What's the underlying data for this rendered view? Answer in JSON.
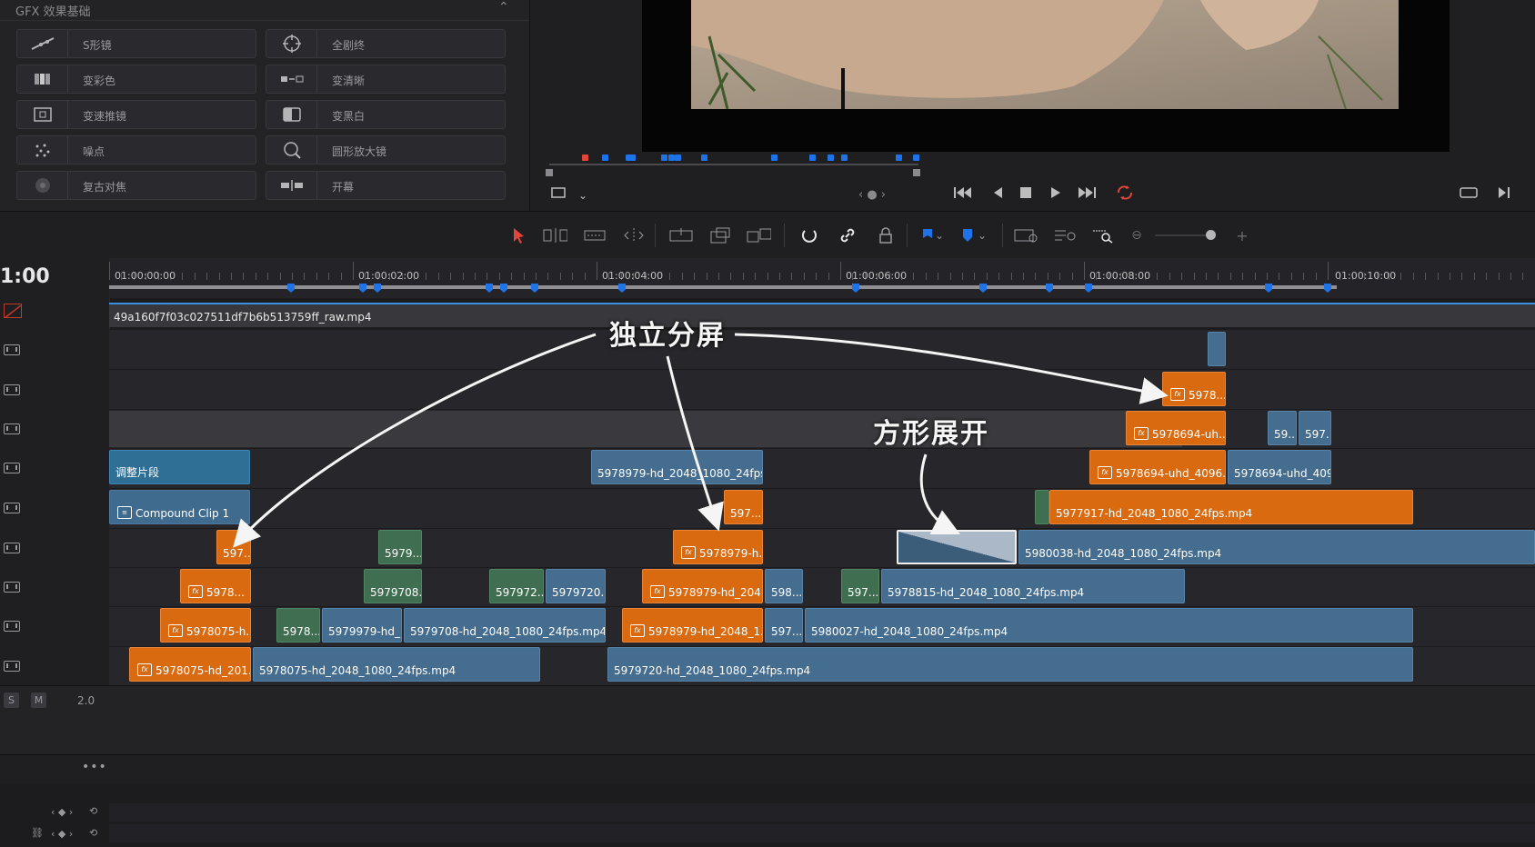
{
  "effects_panel": {
    "title": "GFX 效果基础",
    "items": [
      {
        "label": "S形镜",
        "icon": "s-curve-icon"
      },
      {
        "label": "全剧终",
        "icon": "target-icon"
      },
      {
        "label": "变彩色",
        "icon": "color-bars-icon"
      },
      {
        "label": "变清晰",
        "icon": "sharpen-icon"
      },
      {
        "label": "变速推镜",
        "icon": "zoom-frame-icon"
      },
      {
        "label": "变黑白",
        "icon": "bw-icon"
      },
      {
        "label": "噪点",
        "icon": "noise-icon"
      },
      {
        "label": "圆形放大镜",
        "icon": "magnifier-icon"
      },
      {
        "label": "复古对焦",
        "icon": "focus-icon"
      },
      {
        "label": "开幕",
        "icon": "curtain-icon"
      }
    ]
  },
  "timeline": {
    "timecode": "1:00",
    "ruler_labels": [
      "01:00:00:00",
      "01:00:02:00",
      "01:00:04:00",
      "01:00:06:00",
      "01:00:08:00",
      "01:00:10:00"
    ],
    "reference_clip": "49a160f7f03c027511df7b6b513759ff_raw.mp4",
    "audio": {
      "solo": "S",
      "mute": "M",
      "volume": "2.0"
    },
    "more": "•••",
    "clips": [
      {
        "label": "调整片段"
      },
      {
        "label": "Compound Clip 1"
      },
      {
        "label": "597..."
      },
      {
        "label": "5978..."
      },
      {
        "label": "5978075-h..."
      },
      {
        "label": "5978075-hd_201..."
      },
      {
        "label": "5978075-hd_2048_1080_24fps.mp4"
      },
      {
        "label": "5979..."
      },
      {
        "label": "5979708..."
      },
      {
        "label": "5978..."
      },
      {
        "label": "5979979-hd_..."
      },
      {
        "label": "5979708-hd_2048_1080_24fps.mp4"
      },
      {
        "label": "597972..."
      },
      {
        "label": "5979720..."
      },
      {
        "label": "5978979-hd_2048_1080_24fps...."
      },
      {
        "label": "597..."
      },
      {
        "label": "5978979-h..."
      },
      {
        "label": "5978979-hd_204..."
      },
      {
        "label": "598..."
      },
      {
        "label": "5978979-hd_2048_1..."
      },
      {
        "label": "597..."
      },
      {
        "label": "5979720-hd_2048_1080_24fps.mp4"
      },
      {
        "label": "597..."
      },
      {
        "label": "5978815-hd_2048_1080_24fps.mp4"
      },
      {
        "label": "5980027-hd_2048_1080_24fps.mp4"
      },
      {
        "label": "5980038-hd_2048_1080_24fps.mp4"
      },
      {
        "label": "5977917-hd_2048_1080_24fps.mp4"
      },
      {
        "label": "5978694-uhd_4096..."
      },
      {
        "label": "5978694-uhd_409..."
      },
      {
        "label": "5978694-uh..."
      },
      {
        "label": "59..."
      },
      {
        "label": "597..."
      },
      {
        "label": "5978..."
      }
    ]
  },
  "annotations": {
    "split_screen": "独立分屏",
    "square_expand": "方形展开"
  },
  "colors": {
    "clip_orange": "#d96a10",
    "clip_blue": "#456d8f",
    "clip_green": "#3f6e50",
    "marker_blue": "#1e73e8",
    "loop_red": "#e2463b"
  }
}
